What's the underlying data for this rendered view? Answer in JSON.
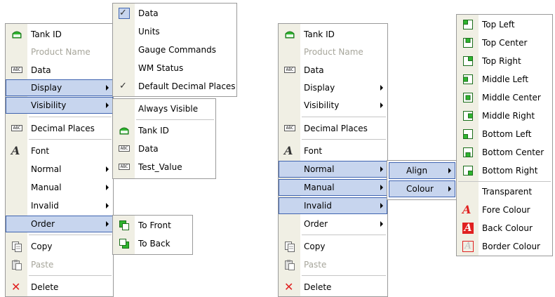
{
  "left_menu": {
    "items": [
      {
        "label": "Tank ID",
        "icon": "tank-icon"
      },
      {
        "label": "Product Name",
        "disabled": true
      },
      {
        "label": "Data",
        "icon": "abc-icon"
      },
      {
        "label": "Display",
        "highlighted": true,
        "submenu": true
      },
      {
        "label": "Visibility",
        "highlighted": true,
        "submenu": true
      },
      {
        "label": "Decimal Places",
        "icon": "abc-icon"
      },
      {
        "label": "Font",
        "icon": "font-icon"
      },
      {
        "label": "Normal",
        "submenu": true
      },
      {
        "label": "Manual",
        "submenu": true
      },
      {
        "label": "Invalid",
        "submenu": true
      },
      {
        "label": "Order",
        "highlighted": true,
        "submenu": true
      },
      {
        "label": "Copy",
        "icon": "copy-icon"
      },
      {
        "label": "Paste",
        "icon": "paste-icon",
        "disabled": true
      },
      {
        "label": "Delete",
        "icon": "delete-icon"
      }
    ]
  },
  "display_submenu": {
    "items": [
      {
        "label": "Data",
        "checked": true
      },
      {
        "label": "Units"
      },
      {
        "label": "Gauge Commands"
      },
      {
        "label": "WM Status"
      },
      {
        "label": "Default Decimal Places",
        "checked": true
      }
    ]
  },
  "visibility_submenu": {
    "items": [
      {
        "label": "Always Visible"
      },
      {
        "label": "Tank ID",
        "icon": "tank-icon"
      },
      {
        "label": "Data",
        "icon": "abc-icon"
      },
      {
        "label": "Test_Value",
        "icon": "abc-icon"
      }
    ]
  },
  "order_submenu": {
    "items": [
      {
        "label": "To Front",
        "icon": "bring-to-front-icon"
      },
      {
        "label": "To Back",
        "icon": "send-to-back-icon"
      }
    ]
  },
  "right_menu": {
    "items": [
      {
        "label": "Tank ID"
      },
      {
        "label": "Product Name",
        "disabled": true
      },
      {
        "label": "Data"
      },
      {
        "label": "Display",
        "submenu": true
      },
      {
        "label": "Visibility",
        "submenu": true
      },
      {
        "label": "Decimal Places"
      },
      {
        "label": "Font"
      },
      {
        "label": "Normal",
        "highlighted": true,
        "submenu": true
      },
      {
        "label": "Manual",
        "highlighted": true,
        "submenu": true
      },
      {
        "label": "Invalid",
        "highlighted": true,
        "submenu": true
      },
      {
        "label": "Order",
        "submenu": true
      },
      {
        "label": "Copy"
      },
      {
        "label": "Paste",
        "disabled": true
      },
      {
        "label": "Delete"
      }
    ]
  },
  "style_submenu": {
    "items": [
      {
        "label": "Align",
        "highlighted": true,
        "submenu": true
      },
      {
        "label": "Colour",
        "highlighted": true,
        "submenu": true
      }
    ]
  },
  "align_colour_submenu": {
    "items": [
      {
        "label": "Top Left",
        "icon": "align-top-left-icon"
      },
      {
        "label": "Top Center",
        "icon": "align-top-center-icon"
      },
      {
        "label": "Top Right",
        "icon": "align-top-right-icon"
      },
      {
        "label": "Middle Left",
        "icon": "align-middle-left-icon"
      },
      {
        "label": "Middle Center",
        "icon": "align-middle-center-icon"
      },
      {
        "label": "Middle Right",
        "icon": "align-middle-right-icon"
      },
      {
        "label": "Bottom Left",
        "icon": "align-bottom-left-icon"
      },
      {
        "label": "Bottom Center",
        "icon": "align-bottom-center-icon"
      },
      {
        "label": "Bottom Right",
        "icon": "align-bottom-right-icon"
      },
      {
        "label": "Transparent"
      },
      {
        "label": "Fore Colour",
        "icon": "fore-colour-icon"
      },
      {
        "label": "Back Colour",
        "icon": "back-colour-icon"
      },
      {
        "label": "Border Colour",
        "icon": "border-colour-icon"
      }
    ]
  },
  "colors": {
    "highlight_fill": "#c7d5ee",
    "highlight_border": "#3f64b0",
    "gutter": "#f0efe4",
    "icon_green": "#2fb52f",
    "icon_red": "#e02020"
  }
}
